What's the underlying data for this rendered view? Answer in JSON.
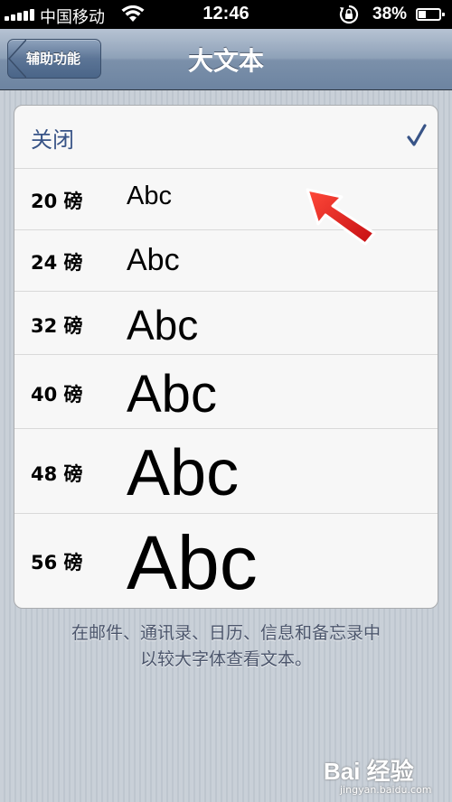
{
  "status_bar": {
    "carrier": "中国移动",
    "time": "12:46",
    "battery_percent": "38%",
    "battery_level": 0.38
  },
  "nav": {
    "back_label": "辅助功能",
    "title": "大文本"
  },
  "options": {
    "off_label": "关闭",
    "off_selected": true,
    "sizes": [
      {
        "label": "20 磅",
        "sample": "Abc",
        "pt": 20
      },
      {
        "label": "24 磅",
        "sample": "Abc",
        "pt": 24
      },
      {
        "label": "32 磅",
        "sample": "Abc",
        "pt": 32
      },
      {
        "label": "40 磅",
        "sample": "Abc",
        "pt": 40
      },
      {
        "label": "48 磅",
        "sample": "Abc",
        "pt": 48
      },
      {
        "label": "56 磅",
        "sample": "Abc",
        "pt": 56
      }
    ]
  },
  "footnote": {
    "line1": "在邮件、通讯录、日历、信息和备忘录中",
    "line2": "以较大字体查看文本。"
  },
  "watermark": {
    "logo": "Bai 经验",
    "sub": "jingyan.baidu.com"
  },
  "colors": {
    "accent": "#385487",
    "annotation_arrow": "#e8141c"
  },
  "icons": [
    "signal-icon",
    "wifi-icon",
    "rotation-lock-icon",
    "battery-icon",
    "back-arrow-icon",
    "checkmark-icon",
    "red-arrow-annotation"
  ]
}
